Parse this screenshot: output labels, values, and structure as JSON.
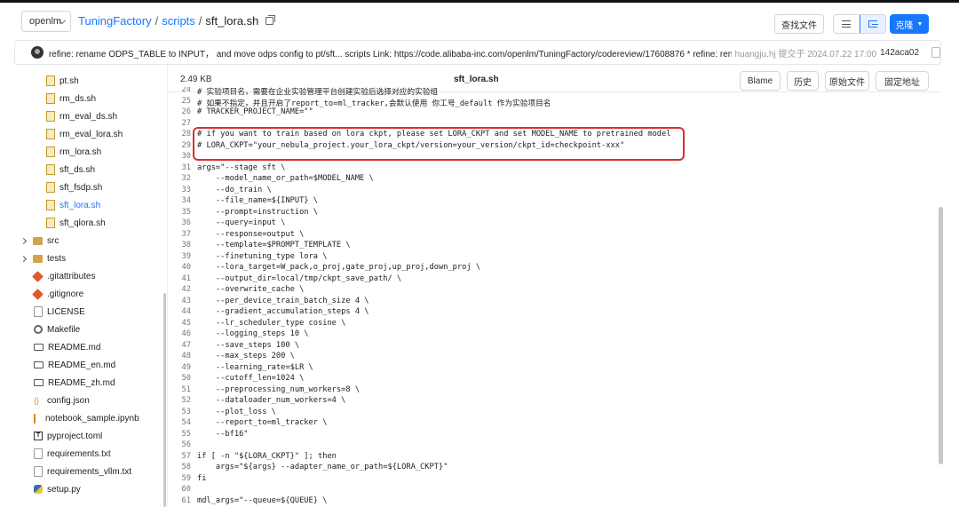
{
  "header": {
    "branch": "openlm",
    "breadcrumb": [
      "TuningFactory",
      "scripts",
      "sft_lora.sh"
    ],
    "separator": "/",
    "find_file": "查找文件",
    "clone": "克隆"
  },
  "commit": {
    "message": "refine: rename ODPS_TABLE to INPUT，  and move odps config to pt/sft... scripts Link: https://code.alibaba-inc.com/openlm/TuningFactory/codereview/17608876 * refine: rename ODPS_TA...",
    "author": "huangju.hj 提交于 2024.07.22 17:00",
    "sha": "142aca02"
  },
  "sidebar": {
    "items": [
      {
        "label": "pt.sh",
        "icon": "file-icon"
      },
      {
        "label": "rm_ds.sh",
        "icon": "file-icon"
      },
      {
        "label": "rm_eval_ds.sh",
        "icon": "file-icon"
      },
      {
        "label": "rm_eval_lora.sh",
        "icon": "file-icon"
      },
      {
        "label": "rm_lora.sh",
        "icon": "file-icon"
      },
      {
        "label": "sft_ds.sh",
        "icon": "file-icon"
      },
      {
        "label": "sft_fsdp.sh",
        "icon": "file-icon"
      },
      {
        "label": "sft_lora.sh",
        "icon": "file-icon"
      },
      {
        "label": "sft_qlora.sh",
        "icon": "file-icon"
      },
      {
        "label": "src",
        "icon": "folder-icon"
      },
      {
        "label": "tests",
        "icon": "folder-icon"
      },
      {
        "label": ".gitattributes",
        "icon": "git-icon"
      },
      {
        "label": ".gitignore",
        "icon": "git-icon"
      },
      {
        "label": "LICENSE",
        "icon": "file-icon"
      },
      {
        "label": "Makefile",
        "icon": "gear-icon"
      },
      {
        "label": "README.md",
        "icon": "markdown-icon"
      },
      {
        "label": "README_en.md",
        "icon": "markdown-icon"
      },
      {
        "label": "README_zh.md",
        "icon": "markdown-icon"
      },
      {
        "label": "config.json",
        "icon": "json-icon"
      },
      {
        "label": "notebook_sample.ipynb",
        "icon": "notebook-icon"
      },
      {
        "label": "pyproject.toml",
        "icon": "toml-icon"
      },
      {
        "label": "requirements.txt",
        "icon": "file-icon"
      },
      {
        "label": "requirements_vllm.txt",
        "icon": "file-icon"
      },
      {
        "label": "setup.py",
        "icon": "python-icon"
      }
    ]
  },
  "file": {
    "size": "2.49 KB",
    "name": "sft_lora.sh",
    "actions": [
      "Blame",
      "历史",
      "原始文件",
      "固定地址"
    ]
  },
  "code": {
    "lines": [
      {
        "n": "24",
        "t": "# 实验项目名，需要在企业实验管理平台创建实验后选择对应的实验组"
      },
      {
        "n": "25",
        "t": "# 如果不指定，并且开启了report_to=ml_tracker,会默认使用 你工号_default 作为实验项目名"
      },
      {
        "n": "26",
        "t": "# TRACKER_PROJECT_NAME=\"\""
      },
      {
        "n": "27",
        "t": ""
      },
      {
        "n": "28",
        "t": "# if you want to train based on lora ckpt, please set LORA_CKPT and set MODEL_NAME to pretrained model"
      },
      {
        "n": "29",
        "t": "# LORA_CKPT=\"your_nebula_project.your_lora_ckpt/version=your_version/ckpt_id=checkpoint-xxx\""
      },
      {
        "n": "30",
        "t": ""
      },
      {
        "n": "31",
        "t": "args=\"--stage sft \\"
      },
      {
        "n": "32",
        "t": "    --model_name_or_path=$MODEL_NAME \\"
      },
      {
        "n": "33",
        "t": "    --do_train \\"
      },
      {
        "n": "34",
        "t": "    --file_name=${INPUT} \\"
      },
      {
        "n": "35",
        "t": "    --prompt=instruction \\"
      },
      {
        "n": "36",
        "t": "    --query=input \\"
      },
      {
        "n": "37",
        "t": "    --response=output \\"
      },
      {
        "n": "38",
        "t": "    --template=$PROMPT_TEMPLATE \\"
      },
      {
        "n": "39",
        "t": "    --finetuning_type lora \\"
      },
      {
        "n": "40",
        "t": "    --lora_target=W_pack,o_proj,gate_proj,up_proj,down_proj \\"
      },
      {
        "n": "41",
        "t": "    --output_dir=local/tmp/ckpt_save_path/ \\"
      },
      {
        "n": "42",
        "t": "    --overwrite_cache \\"
      },
      {
        "n": "43",
        "t": "    --per_device_train_batch_size 4 \\"
      },
      {
        "n": "44",
        "t": "    --gradient_accumulation_steps 4 \\"
      },
      {
        "n": "45",
        "t": "    --lr_scheduler_type cosine \\"
      },
      {
        "n": "46",
        "t": "    --logging_steps 10 \\"
      },
      {
        "n": "47",
        "t": "    --save_steps 100 \\"
      },
      {
        "n": "48",
        "t": "    --max_steps 200 \\"
      },
      {
        "n": "49",
        "t": "    --learning_rate=$LR \\"
      },
      {
        "n": "50",
        "t": "    --cutoff_len=1024 \\"
      },
      {
        "n": "51",
        "t": "    --preprocessing_num_workers=8 \\"
      },
      {
        "n": "52",
        "t": "    --dataloader_num_workers=4 \\"
      },
      {
        "n": "53",
        "t": "    --plot_loss \\"
      },
      {
        "n": "54",
        "t": "    --report_to=ml_tracker \\"
      },
      {
        "n": "55",
        "t": "    --bf16\""
      },
      {
        "n": "56",
        "t": ""
      },
      {
        "n": "57",
        "t": "if [ -n \"${LORA_CKPT}\" ]; then"
      },
      {
        "n": "58",
        "t": "    args=\"${args} --adapter_name_or_path=${LORA_CKPT}\""
      },
      {
        "n": "59",
        "t": "fi"
      },
      {
        "n": "60",
        "t": ""
      },
      {
        "n": "61",
        "t": "mdl_args=\"--queue=${QUEUE} \\"
      }
    ]
  },
  "colors": {
    "accent": "#1677ff",
    "highlight_border": "#d9302c"
  }
}
